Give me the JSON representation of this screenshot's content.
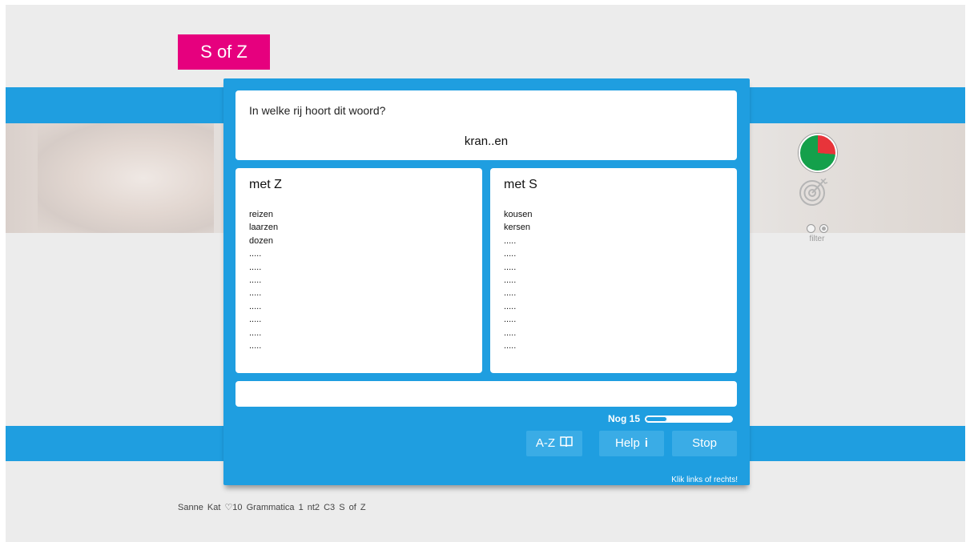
{
  "header": {
    "title": "S of Z"
  },
  "question": {
    "prompt": "In welke rij hoort dit woord?",
    "word": "kran..en"
  },
  "columns": [
    {
      "heading": "met Z",
      "items": [
        "reizen",
        "laarzen",
        "dozen",
        ".....",
        ".....",
        ".....",
        ".....",
        ".....",
        ".....",
        ".....",
        "....."
      ]
    },
    {
      "heading": "met S",
      "items": [
        "kousen",
        "kersen",
        ".....",
        ".....",
        ".....",
        ".....",
        ".....",
        ".....",
        ".....",
        ".....",
        "....."
      ]
    }
  ],
  "answer": {
    "value": ""
  },
  "status": {
    "remaining_label": "Nog 15",
    "progress_fraction": 0.25
  },
  "buttons": {
    "az_label": "A-Z",
    "az_icon": "book-icon",
    "help_label": "Help",
    "help_icon": "i",
    "stop_label": "Stop"
  },
  "hint": "Klik links of rechts!",
  "sidebar": {
    "filter_label": "filter",
    "pie_colors": {
      "wrong": "#e8343a",
      "right": "#14a04b"
    }
  },
  "footer": {
    "user": "Sanne Kat",
    "hearts": "♡10",
    "course": "Grammatica 1 nt2",
    "lesson": "C3 S of Z"
  },
  "colors": {
    "accent_blue": "#1f9ee0",
    "brand_pink": "#e6007e"
  }
}
